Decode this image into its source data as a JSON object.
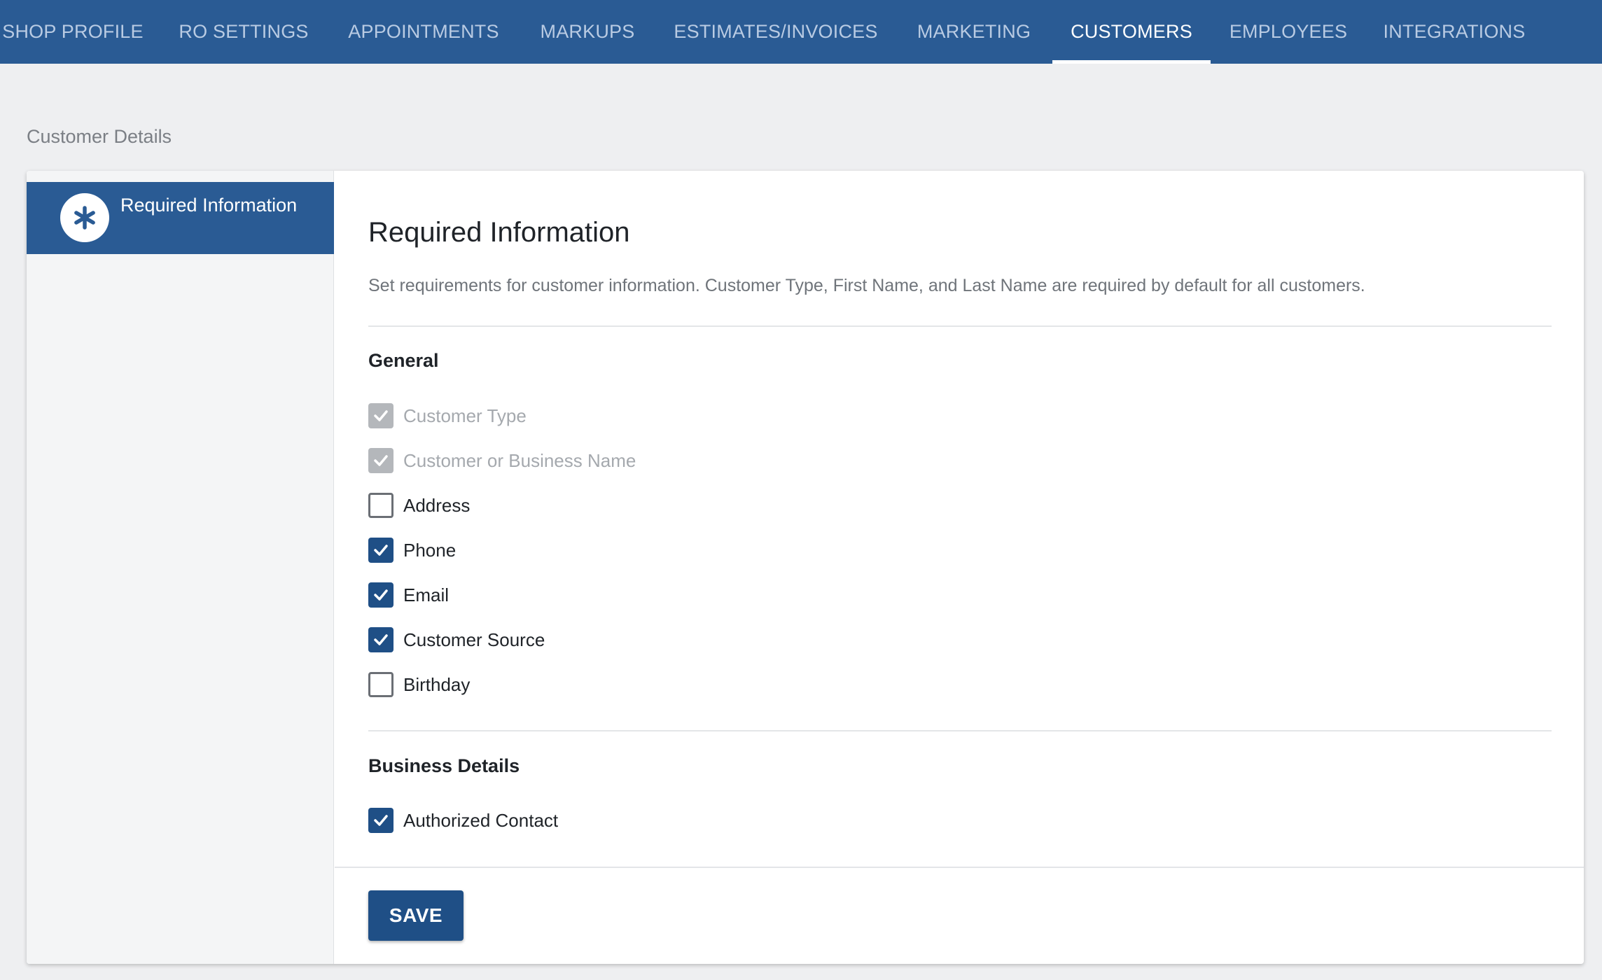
{
  "nav": {
    "tabs": [
      {
        "label": "SHOP PROFILE"
      },
      {
        "label": "RO SETTINGS"
      },
      {
        "label": "APPOINTMENTS"
      },
      {
        "label": "MARKUPS"
      },
      {
        "label": "ESTIMATES/INVOICES"
      },
      {
        "label": "MARKETING"
      },
      {
        "label": "CUSTOMERS",
        "active": true
      },
      {
        "label": "EMPLOYEES"
      },
      {
        "label": "INTEGRATIONS"
      }
    ]
  },
  "page": {
    "section_label": "Customer Details"
  },
  "sidebar": {
    "items": [
      {
        "label": "Required Information",
        "icon": "asterisk-icon",
        "active": true
      }
    ]
  },
  "main": {
    "title": "Required Information",
    "description": "Set requirements for customer information. Customer Type, First Name, and Last Name are required by default for all customers.",
    "groups": [
      {
        "title": "General",
        "fields": [
          {
            "label": "Customer Type",
            "checked": true,
            "disabled": true
          },
          {
            "label": "Customer or Business Name",
            "checked": true,
            "disabled": true
          },
          {
            "label": "Address",
            "checked": false,
            "disabled": false
          },
          {
            "label": "Phone",
            "checked": true,
            "disabled": false
          },
          {
            "label": "Email",
            "checked": true,
            "disabled": false
          },
          {
            "label": "Customer Source",
            "checked": true,
            "disabled": false
          },
          {
            "label": "Birthday",
            "checked": false,
            "disabled": false
          }
        ]
      },
      {
        "title": "Business Details",
        "fields": [
          {
            "label": "Authorized Contact",
            "checked": true,
            "disabled": false
          }
        ]
      }
    ],
    "save_label": "SAVE"
  },
  "colors": {
    "brand": "#2a5b94",
    "checkbox_checked": "#1f4f86",
    "checkbox_disabled": "#b4b7bb"
  }
}
